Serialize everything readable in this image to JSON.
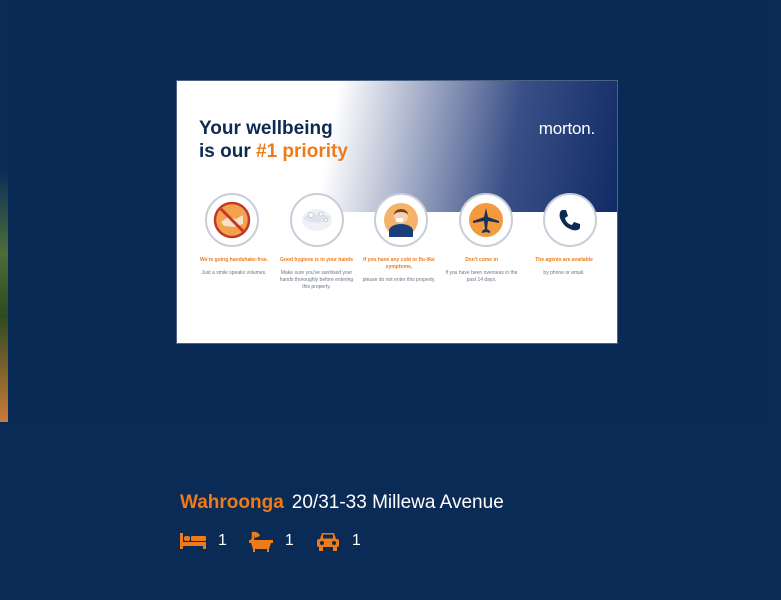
{
  "banner": {
    "headline_line1": "Your wellbeing",
    "headline_line2_prefix": "is our ",
    "headline_accent": "#1 priority",
    "brand": "morton.",
    "tips": [
      {
        "heading": "We're going handshake-free.",
        "body": "Just a smile speaks volumes."
      },
      {
        "heading": "Good hygiene is in your hands",
        "body": "Make sure you've sanitised your hands thoroughly before entering this property."
      },
      {
        "heading": "If you have any cold or flu-like symptoms,",
        "body": "please do not enter this property."
      },
      {
        "heading": "Don't come in",
        "body": "if you have been overseas in the past 14 days."
      },
      {
        "heading": "The agents are available",
        "body": "by phone or email."
      }
    ]
  },
  "listing": {
    "suburb": "Wahroonga",
    "address": "20/31-33 Millewa Avenue",
    "bedrooms": "1",
    "bathrooms": "1",
    "parking": "1"
  },
  "colors": {
    "background": "#0b2b57",
    "accent": "#ee7b1a",
    "navy": "#0d2a55"
  },
  "icons": [
    "no-handshake-icon",
    "hand-wash-icon",
    "sick-person-icon",
    "airplane-icon",
    "phone-icon",
    "bed-icon",
    "bath-icon",
    "car-icon"
  ]
}
